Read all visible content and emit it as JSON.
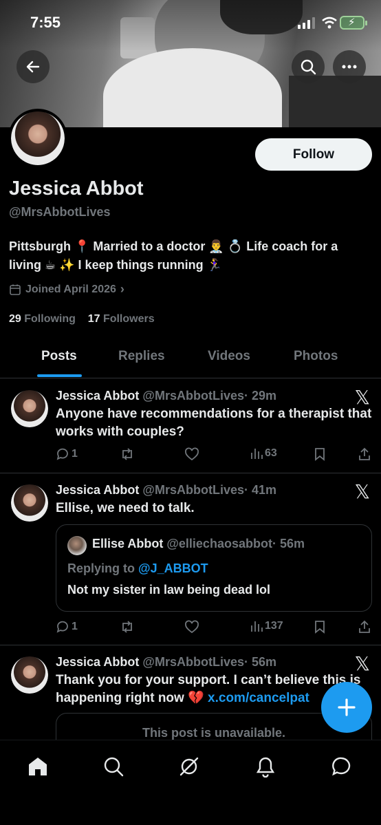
{
  "status_bar": {
    "time": "7:55"
  },
  "profile": {
    "name": "Jessica Abbot",
    "handle": "@MrsAbbotLives",
    "bio": "Pittsburgh 📍 Married to a doctor 👨‍⚕️ 💍 Life coach for a living ☕ ✨ I keep things running 🏃‍♀️",
    "joined": "Joined April 2026",
    "following_count": "29",
    "following_label": "Following",
    "followers_count": "17",
    "followers_label": "Followers",
    "follow_label": "Follow"
  },
  "tabs": [
    "Posts",
    "Replies",
    "Videos",
    "Photos"
  ],
  "posts": [
    {
      "name": "Jessica Abbot",
      "handle": "@MrsAbbotLives",
      "time": "· 29m",
      "text": "Anyone have recommendations for a therapist that works with couples?",
      "replies": "1",
      "views": "63"
    },
    {
      "name": "Jessica Abbot",
      "handle": "@MrsAbbotLives",
      "time": "· 41m",
      "text": "Ellise, we need to talk.",
      "replies": "1",
      "views": "137",
      "quote": {
        "name": "Ellise Abbot",
        "handle": "@elliechaosabbot",
        "time": "· 56m",
        "replying_to": "Replying to",
        "mention": "@J_ABBOT",
        "text": "Not my sister in law being dead lol"
      }
    },
    {
      "name": "Jessica Abbot",
      "handle": "@MrsAbbotLives",
      "time": "· 56m",
      "text": "Thank you for your support. I can’t believe this is happening right now 💔",
      "link": "x.com/cancelpat",
      "unavailable": "This post is unavailable."
    }
  ],
  "icons": {
    "back": "arrow-left-icon",
    "search": "search-icon",
    "more": "more-icon",
    "calendar": "calendar-icon",
    "reply": "reply-icon",
    "repost": "repost-icon",
    "like": "like-icon",
    "views": "views-icon",
    "bookmark": "bookmark-icon",
    "share": "share-icon",
    "x_logo": "x-logo-icon",
    "compose": "plus-icon",
    "nav": [
      "home-icon",
      "search-icon",
      "grok-icon",
      "notifications-icon",
      "messages-icon"
    ]
  },
  "colors": {
    "accent": "#1d9bf0",
    "text": "#e7e9ea",
    "muted": "#71767b",
    "background": "#000000"
  }
}
